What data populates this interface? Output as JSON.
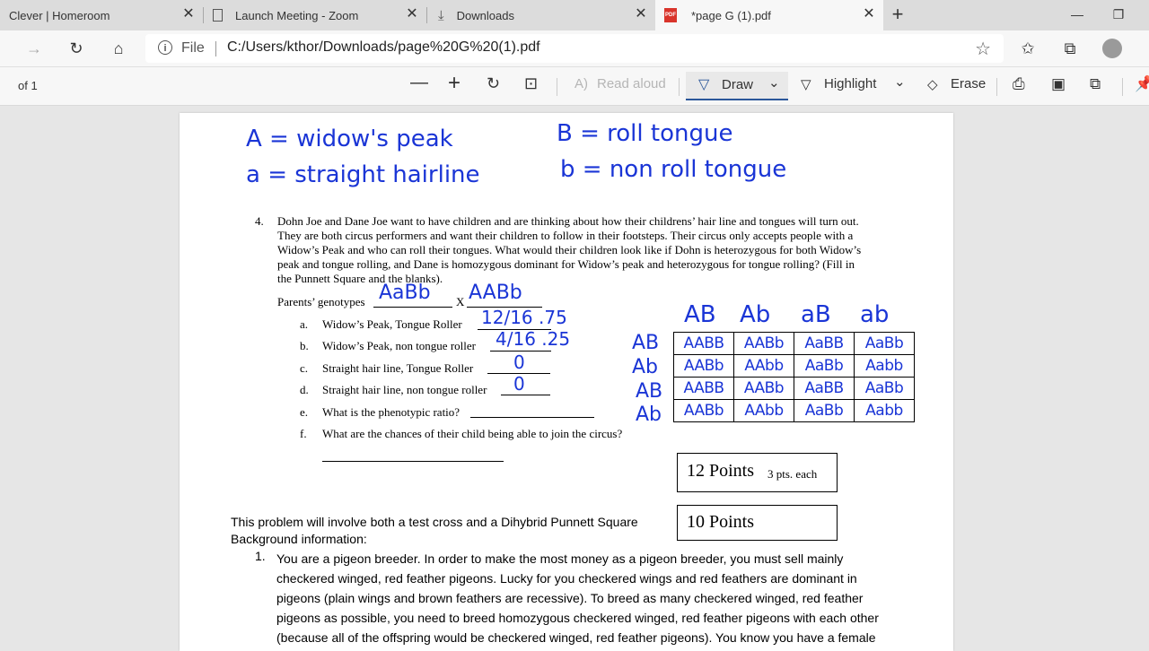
{
  "tabs": [
    {
      "title": "Clever | Homeroom",
      "icon": "none"
    },
    {
      "title": "Launch Meeting - Zoom",
      "icon": "page-icon"
    },
    {
      "title": "Downloads",
      "icon": "download-icon"
    },
    {
      "title": "*page G (1).pdf",
      "icon": "pdf-icon",
      "active": true
    }
  ],
  "address": {
    "scheme": "File",
    "url": "C:/Users/kthor/Downloads/page%20G%20(1).pdf"
  },
  "pdf_toolbar": {
    "page_of": "of 1",
    "read_aloud": "Read aloud",
    "draw": "Draw",
    "highlight": "Highlight",
    "erase": "Erase"
  },
  "handwriting": {
    "a_upper": "A = widow's peak",
    "a_lower": "a = straight hairline",
    "b_upper": "B = roll tongue",
    "b_lower": "b = non roll tongue",
    "genotype1": "AaBb",
    "genotype2": "AABb",
    "answer_a": "12/16 .75",
    "answer_b": "4/16 .25",
    "answer_c": "0",
    "answer_d": "0"
  },
  "question": {
    "number": "4.",
    "lines": [
      "Dohn Joe and Dane Joe want to have children and are thinking about how their childrens’ hair line and tongues will turn out.",
      "They are both circus performers and want their children to follow in their footsteps. Their circus only accepts people with a",
      "Widow’s Peak and who can roll their tongues. What would their children look like if Dohn is heterozygous for both Widow’s",
      "peak and tongue rolling, and Dane is homozygous dominant for Widow’s peak and heterozygous for tongue rolling? (Fill in",
      "the Punnett Square and the blanks)."
    ],
    "parents_label": "Parents’ genotypes",
    "cross": "X",
    "subs": [
      {
        "letter": "a.",
        "text": "Widow’s Peak, Tongue Roller"
      },
      {
        "letter": "b.",
        "text": "Widow’s Peak, non tongue roller"
      },
      {
        "letter": "c.",
        "text": "Straight hair line, Tongue Roller"
      },
      {
        "letter": "d.",
        "text": "Straight hair line, non tongue roller"
      },
      {
        "letter": "e.",
        "text": "What is the phenotypic ratio?"
      },
      {
        "letter": "f.",
        "text": "What are the chances of their child being able to join the circus?"
      }
    ]
  },
  "punnett": {
    "col_headers": [
      "AB",
      "Ab",
      "aB",
      "ab"
    ],
    "row_headers": [
      "AB",
      "Ab",
      "AB",
      "Ab"
    ],
    "cells": [
      [
        "AABB",
        "AABb",
        "AaBB",
        "AaBb"
      ],
      [
        "AABb",
        "AAbb",
        "AaBb",
        "Aabb"
      ],
      [
        "AABB",
        "AABb",
        "AaBB",
        "AaBb"
      ],
      [
        "AABb",
        "AAbb",
        "AaBb",
        "Aabb"
      ]
    ]
  },
  "points_box1": {
    "big": "12 Points",
    "small": "3 pts. each"
  },
  "points_box2": {
    "big": "10 Points"
  },
  "section2": {
    "intro": "This problem will involve both a test cross and a Dihybrid Punnett Square",
    "background": "Background information:",
    "number": "1.",
    "lines": [
      "You are a pigeon breeder.  In order to make the most money as a pigeon breeder, you must sell mainly",
      "checkered winged, red feather pigeons.  Lucky for you checkered wings and red feathers are dominant in",
      "pigeons (plain wings and brown feathers are recessive). To breed as many checkered winged, red feather",
      "pigeons as possible, you need to breed homozygous checkered winged, red feather pigeons with each other",
      "(because all of the offspring would be checkered winged, red feather pigeons). You know you have a female"
    ]
  }
}
